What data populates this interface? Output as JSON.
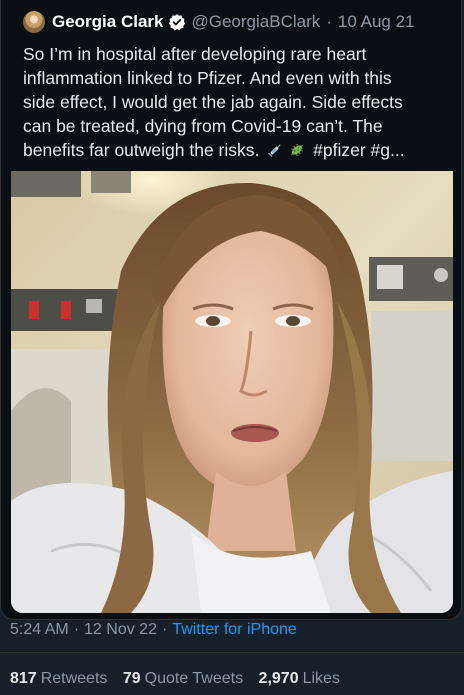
{
  "quoted_tweet": {
    "author_name": "Georgia Clark",
    "handle": "@GeorgiaBClark",
    "separator": "·",
    "date": "10 Aug 21",
    "text_lines": [
      "So I’m in hospital after developing rare heart",
      "inflammation linked to Pfizer. And even with this",
      "side effect, I would get the jab again. Side effects",
      "can be treated, dying from Covid-19 can’t. The"
    ],
    "last_line_text": "benefits far outweigh the risks.",
    "hashtags_text": "#pfizer #g...",
    "emojis": [
      "syringe-icon",
      "microbe-icon"
    ],
    "verified_icon": "verified-badge-icon",
    "video_description_icon": "video-thumbnail"
  },
  "meta": {
    "time": "5:24 AM",
    "dot": "·",
    "date": "12 Nov 22",
    "source": "Twitter for iPhone"
  },
  "stats": {
    "retweets_count": "817",
    "retweets_label": "Retweets",
    "quote_count": "79",
    "quote_label": "Quote Tweets",
    "likes_count": "2,970",
    "likes_label": "Likes"
  },
  "colors": {
    "background": "#15202b",
    "card_background": "#0a0f14",
    "link": "#1d9bf0",
    "secondary_text": "#8b98a5",
    "primary_text": "#e7e9ea",
    "verified": "#ffffff"
  }
}
